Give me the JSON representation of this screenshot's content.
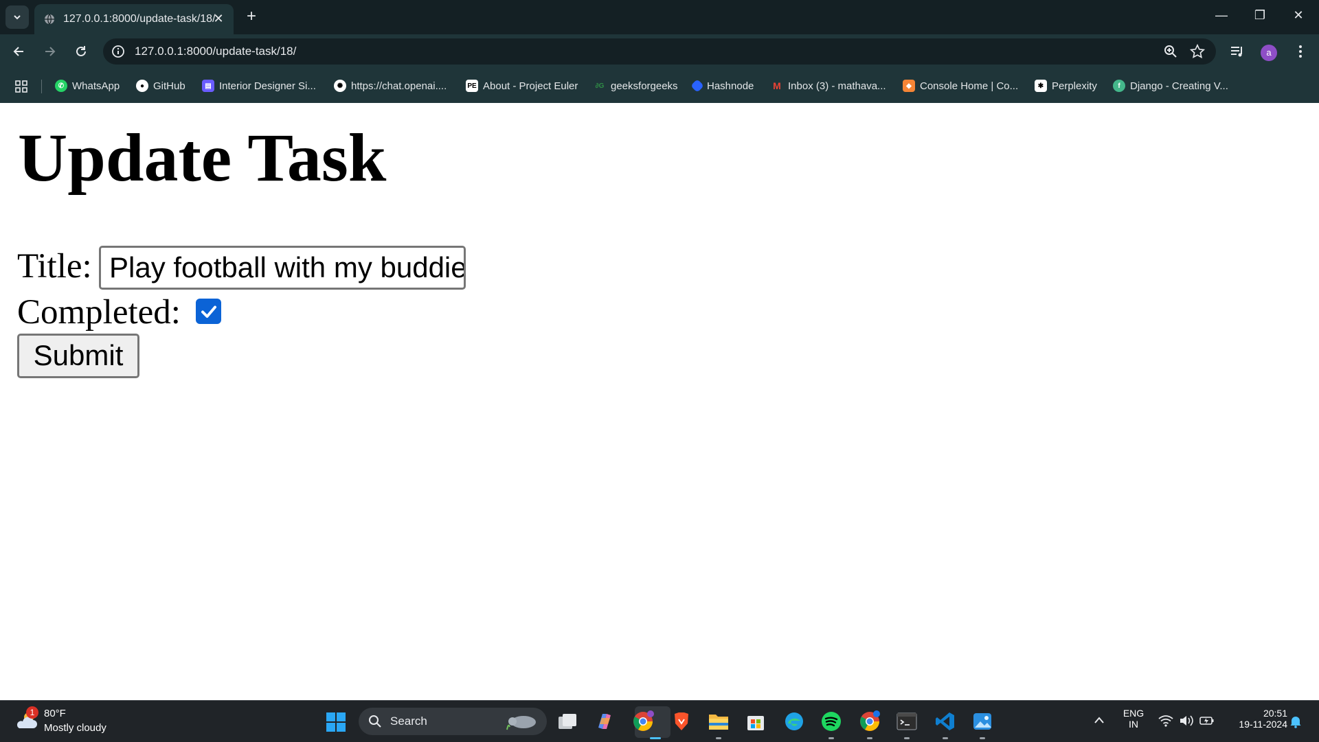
{
  "browser": {
    "tab": {
      "title": "127.0.0.1:8000/update-task/18/",
      "close_glyph": "✕"
    },
    "new_tab_glyph": "+",
    "url": "127.0.0.1:8000/update-task/18/",
    "profile_initial": "a",
    "window_controls": {
      "minimize": "—",
      "restore": "❐",
      "close": "✕"
    },
    "bookmarks": [
      {
        "label": "WhatsApp",
        "icon": "whatsapp-icon",
        "color": "#25d366"
      },
      {
        "label": "GitHub",
        "icon": "github-icon",
        "color": "#ffffff"
      },
      {
        "label": "Interior Designer Si...",
        "icon": "interior-designer-icon",
        "color": "#6a5cff"
      },
      {
        "label": "https://chat.openai....",
        "icon": "openai-icon",
        "color": "#ffffff"
      },
      {
        "label": "About - Project Euler",
        "icon": "project-euler-icon",
        "color": "#ffffff"
      },
      {
        "label": "geeksforgeeks",
        "icon": "geeksforgeeks-icon",
        "color": "#2f8d46"
      },
      {
        "label": "Hashnode",
        "icon": "hashnode-icon",
        "color": "#2962ff"
      },
      {
        "label": "Inbox (3) - mathava...",
        "icon": "gmail-icon",
        "color": "#ea4335"
      },
      {
        "label": "Console Home | Co...",
        "icon": "aws-console-icon",
        "color": "#f58536"
      },
      {
        "label": "Perplexity",
        "icon": "perplexity-icon",
        "color": "#ffffff"
      },
      {
        "label": "Django - Creating V...",
        "icon": "django-icon",
        "color": "#44b78b"
      }
    ]
  },
  "page": {
    "heading": "Update Task",
    "title_label": "Title:",
    "title_value": "Play football with my buddies",
    "completed_label": "Completed:",
    "completed_checked": true,
    "submit_label": "Submit"
  },
  "taskbar": {
    "weather": {
      "temp": "80°F",
      "description": "Mostly cloudy",
      "badge": "1"
    },
    "search_label": "Search",
    "language": {
      "line1": "ENG",
      "line2": "IN"
    },
    "time": "20:51",
    "date": "19-11-2024",
    "apps": [
      "task-view",
      "copilot",
      "chrome",
      "brave",
      "file-explorer",
      "microsoft-store",
      "edge",
      "spotify",
      "chrome-profile",
      "terminal",
      "vscode",
      "photos"
    ]
  },
  "colors": {
    "chrome_dark": "#142024",
    "chrome_toolbar": "#1f3539",
    "checkbox_accent": "#0b63d6",
    "taskbar": "#202428"
  }
}
